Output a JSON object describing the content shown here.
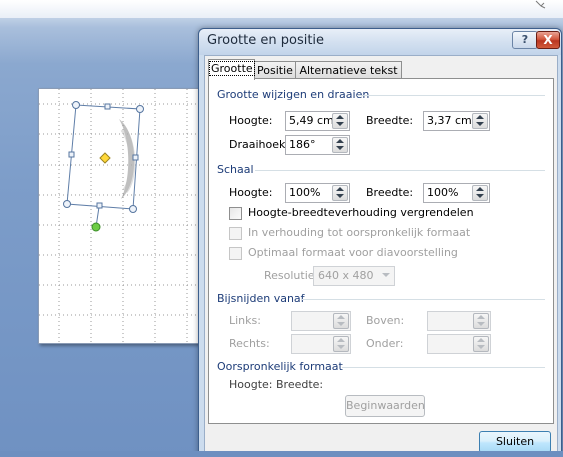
{
  "dialog": {
    "title": "Grootte en positie",
    "help_label": "?",
    "close_label": "X",
    "tabs": [
      {
        "label": "Grootte"
      },
      {
        "label": "Positie"
      },
      {
        "label": "Alternatieve tekst"
      }
    ],
    "size_rotate": {
      "section_title": "Grootte wijzigen en draaien",
      "height_label": "Hoogte:",
      "height_value": "5,49 cm",
      "width_label": "Breedte:",
      "width_value": "3,37 cm",
      "rotation_label": "Draaihoek:",
      "rotation_value": "186°"
    },
    "scale": {
      "section_title": "Schaal",
      "height_label": "Hoogte:",
      "height_value": "100%",
      "width_label": "Breedte:",
      "width_value": "100%",
      "lock_aspect_label": "Hoogte-breedteverhouding vergrendelen",
      "relative_label": "In verhouding tot oorspronkelijk formaat",
      "best_scale_label": "Optimaal formaat voor diavoorstelling",
      "resolution_label": "Resolutie",
      "resolution_value": "640 x 480"
    },
    "crop": {
      "section_title": "Bijsnijden vanaf",
      "left_label": "Links:",
      "top_label": "Boven:",
      "right_label": "Rechts:",
      "bottom_label": "Onder:"
    },
    "original": {
      "section_title": "Oorspronkelijk formaat",
      "info_label": "Hoogte:  Breedte:",
      "reset_label": "Beginwaarden"
    },
    "close_button_label": "Sluiten"
  }
}
